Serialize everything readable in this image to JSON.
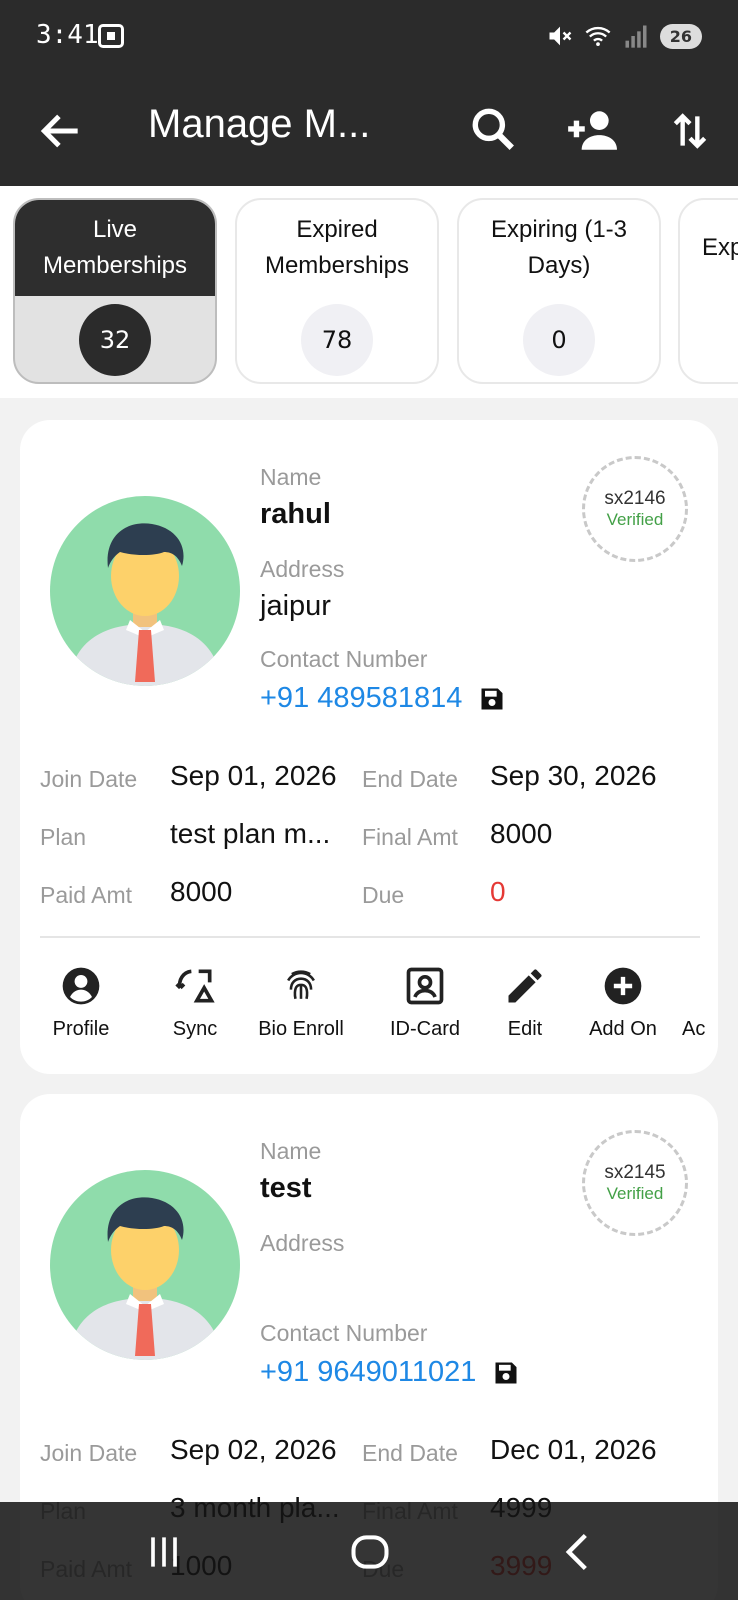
{
  "status_bar": {
    "time": "3:41",
    "battery": "26"
  },
  "app_bar": {
    "title": "Manage M..."
  },
  "tabs": [
    {
      "label": "Live Memberships",
      "count": "32"
    },
    {
      "label": "Expired Memberships",
      "count": "78"
    },
    {
      "label": "Expiring (1-3 Days)",
      "count": "0"
    },
    {
      "label": "Exp",
      "count": ""
    }
  ],
  "field_labels": {
    "name": "Name",
    "address": "Address",
    "contact": "Contact Number",
    "join_date": "Join Date",
    "end_date": "End Date",
    "plan": "Plan",
    "final_amt": "Final Amt",
    "paid_amt": "Paid Amt",
    "due": "Due"
  },
  "members": [
    {
      "id": "sx2146",
      "status": "Verified",
      "name": "rahul",
      "address": "jaipur",
      "contact": "+91 489581814",
      "join_date": "Sep 01, 2026",
      "end_date": "Sep 30, 2026",
      "plan": "test plan m...",
      "final_amt": "8000",
      "paid_amt": "8000",
      "due": "0"
    },
    {
      "id": "sx2145",
      "status": "Verified",
      "name": "test",
      "address": "",
      "contact": "+91 9649011021",
      "join_date": "Sep 02, 2026",
      "end_date": "Dec 01, 2026",
      "plan": "3 month pla...",
      "final_amt": "4999",
      "paid_amt": "1000",
      "due": "3999"
    }
  ],
  "actions": [
    "Profile",
    "Sync",
    "Bio Enroll",
    "ID-Card",
    "Edit",
    "Add On",
    "Ac"
  ],
  "colors": {
    "header": "#2b2b2b",
    "link": "#1e88e5",
    "verified": "#43a047",
    "due": "#e53935"
  }
}
